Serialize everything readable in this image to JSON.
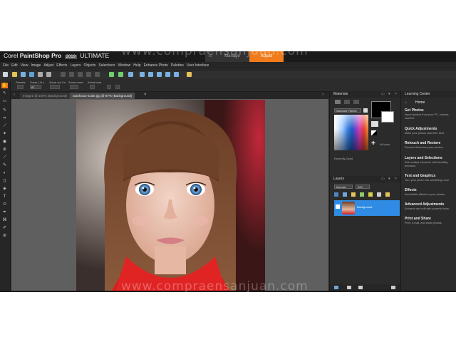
{
  "app": {
    "brand_prefix": "Corel",
    "brand_name": "PaintShop Pro",
    "brand_version": "2019",
    "brand_edition": "ULTIMATE"
  },
  "workspace_tabs": {
    "home_icon": "home-icon",
    "manage": "Manage",
    "adjust": "Adjust"
  },
  "menu": [
    "File",
    "Edit",
    "View",
    "Image",
    "Adjust",
    "Effects",
    "Layers",
    "Objects",
    "Selections",
    "Window",
    "Help",
    "Enhance Photo",
    "Palettes",
    "User Interface"
  ],
  "options_bar": {
    "presets_label": "Presets",
    "zoom_label": "Zoom ( % )",
    "zoom_value": "87",
    "zoom_in_label": "Zoom out / in",
    "zoom_more_label": "Zoom more",
    "actual_size_label": "Actual size"
  },
  "doc_tabs": [
    "Image1 @ 100% (Background)",
    "autofocus-scale.jpg @ 87% (Background)"
  ],
  "materials": {
    "title": "Materials",
    "palette_select": "Standard Palette",
    "recently_used": "Recently Used",
    "all_tools_label": "All tools"
  },
  "layers": {
    "title": "Layers",
    "blend_mode": "Normal",
    "opacity": "100",
    "layer_name": "Background"
  },
  "learning_center": {
    "title": "Learning Center",
    "home": "Home",
    "items": [
      {
        "title": "Get Photos",
        "desc": "Import photos from your PC, camera, scanner."
      },
      {
        "title": "Quick Adjustments",
        "desc": "Make your photos look their best."
      },
      {
        "title": "Retouch and Restore",
        "desc": "Remove flaws from your photos."
      },
      {
        "title": "Layers and Selections",
        "desc": "Edit multiple elements with flexibility, precision."
      },
      {
        "title": "Text and Graphics",
        "desc": "Turn your photo into something more."
      },
      {
        "title": "Effects",
        "desc": "Add artistic effects to your photos."
      },
      {
        "title": "Advanced Adjustments",
        "desc": "Enhance and edit with powerful tools."
      },
      {
        "title": "Print and Share",
        "desc": "Print, e-mail, and share photos."
      }
    ]
  },
  "watermark": "www.compraensanjuan.com",
  "colors": {
    "accent": "#f07b1a",
    "selection": "#2f8be3",
    "panel": "#2b2b2b",
    "canvas_bg": "#5f5f5f"
  }
}
